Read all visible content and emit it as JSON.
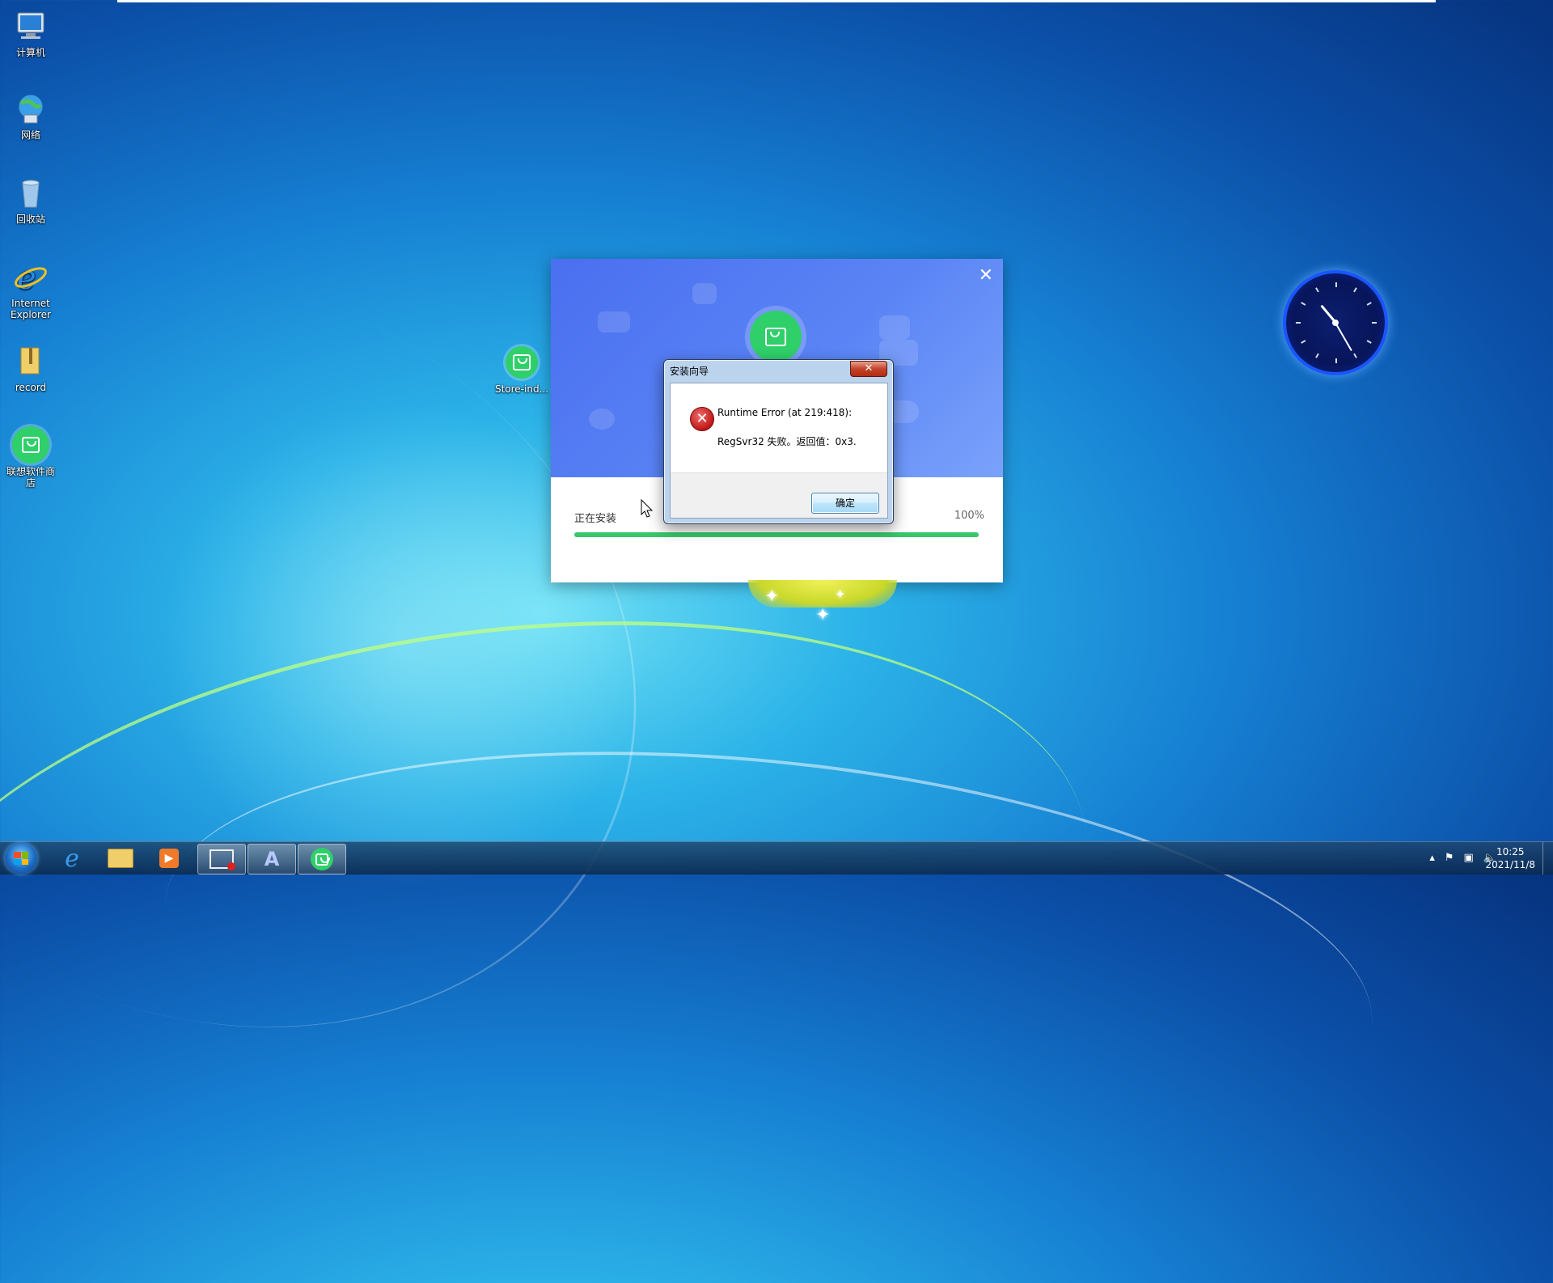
{
  "desktop": {
    "icons": [
      {
        "label": "计算机"
      },
      {
        "label": "网络"
      },
      {
        "label": "回收站"
      },
      {
        "label": "Internet Explorer"
      },
      {
        "label": "record"
      },
      {
        "label": "联想软件商店"
      }
    ],
    "floating_icon": {
      "label": "Store-ind..."
    }
  },
  "installer": {
    "status_text": "正在安装",
    "progress_text": "100%",
    "progress": 1.0,
    "close_glyph": "✕"
  },
  "dialog": {
    "title": "安装向导",
    "message_line1": "Runtime Error (at 219:418):",
    "message_line2": "RegSvr32 失败。返回值：0x3.",
    "ok_label": "确定",
    "close_glyph": "✕",
    "icon": "error-icon"
  },
  "taskbar": {
    "time": "10:25",
    "date": "2021/11/8"
  },
  "colors": {
    "accent_green": "#2fcf6a",
    "installer_blue": "#4a6ff0",
    "error_red": "#c01818"
  }
}
